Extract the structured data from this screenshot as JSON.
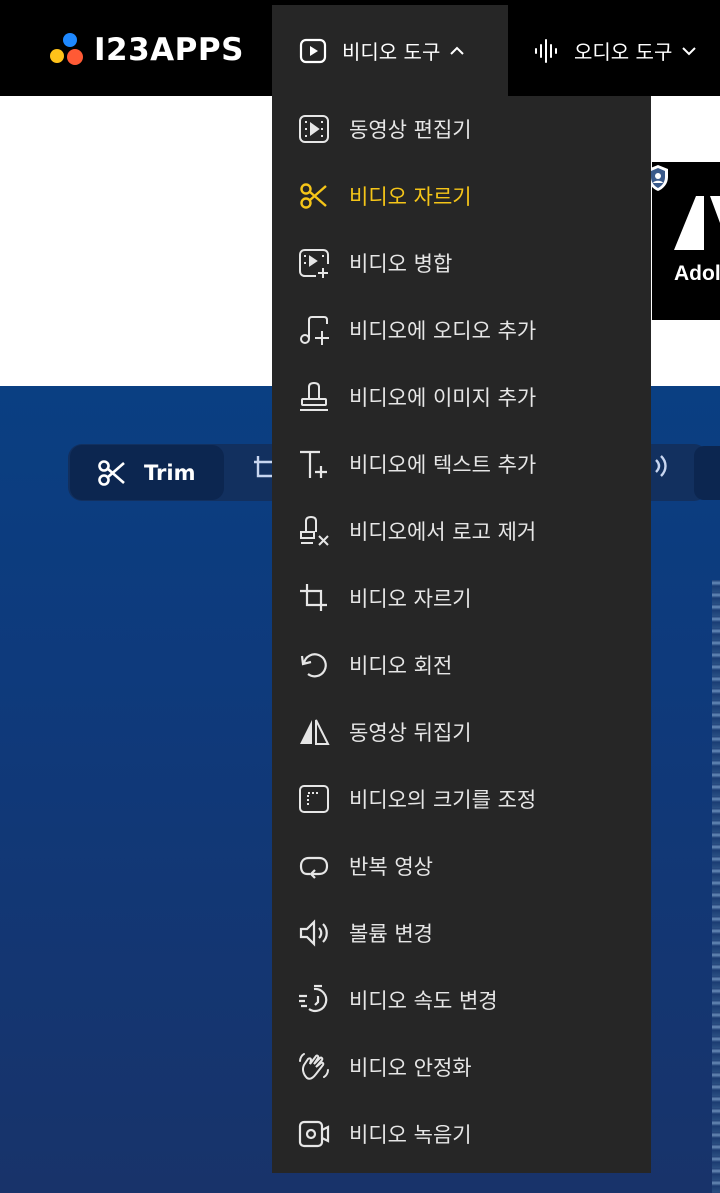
{
  "header": {
    "logo_text": "I23APPS",
    "nav": [
      {
        "label": "비디오 도구",
        "icon": "play-square-icon",
        "chevron": "chevron-up-icon",
        "open": true
      },
      {
        "label": "오디오 도구",
        "icon": "audio-wave-icon",
        "chevron": "chevron-down-icon",
        "open": false
      }
    ]
  },
  "ad": {
    "text": "Adol"
  },
  "toolbar": {
    "trim_label": "Trim"
  },
  "menu": {
    "items": [
      {
        "label": "동영상 편집기",
        "icon": "film-editor-icon",
        "active": false
      },
      {
        "label": "비디오 자르기",
        "icon": "scissors-icon",
        "active": true
      },
      {
        "label": "비디오 병합",
        "icon": "merge-video-icon",
        "active": false
      },
      {
        "label": "비디오에 오디오 추가",
        "icon": "music-add-icon",
        "active": false
      },
      {
        "label": "비디오에 이미지 추가",
        "icon": "stamp-icon",
        "active": false
      },
      {
        "label": "비디오에 텍스트 추가",
        "icon": "text-add-icon",
        "active": false
      },
      {
        "label": "비디오에서 로고 제거",
        "icon": "remove-logo-icon",
        "active": false
      },
      {
        "label": "비디오 자르기",
        "icon": "crop-icon",
        "active": false
      },
      {
        "label": "비디오 회전",
        "icon": "rotate-icon",
        "active": false
      },
      {
        "label": "동영상 뒤집기",
        "icon": "flip-icon",
        "active": false
      },
      {
        "label": "비디오의 크기를 조정",
        "icon": "resize-icon",
        "active": false
      },
      {
        "label": "반복 영상",
        "icon": "loop-icon",
        "active": false
      },
      {
        "label": "볼륨 변경",
        "icon": "volume-icon",
        "active": false
      },
      {
        "label": "비디오 속도 변경",
        "icon": "speed-icon",
        "active": false
      },
      {
        "label": "비디오 안정화",
        "icon": "stabilize-hand-icon",
        "active": false
      },
      {
        "label": "비디오 녹음기",
        "icon": "video-recorder-icon",
        "active": false
      }
    ]
  },
  "colors": {
    "header_bg": "#000000",
    "menu_bg": "#262626",
    "active": "#f5c518",
    "menu_text": "#e6e6e6",
    "blue": "#0a3f82"
  }
}
